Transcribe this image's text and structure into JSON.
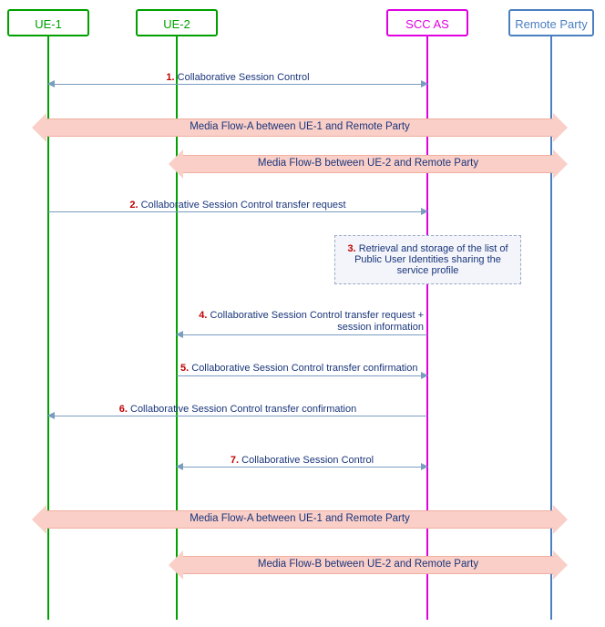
{
  "actors": {
    "ue1": "UE-1",
    "ue2": "UE-2",
    "sccas": "SCC AS",
    "rp": "Remote Party"
  },
  "messages": {
    "m1": {
      "num": "1.",
      "text": "Collaborative Session Control"
    },
    "m2": {
      "num": "2.",
      "text": "Collaborative Session Control transfer request"
    },
    "m4": {
      "num": "4.",
      "text": "Collaborative Session Control transfer request + session information"
    },
    "m5": {
      "num": "5.",
      "text": "Collaborative Session Control transfer confirmation"
    },
    "m6": {
      "num": "6.",
      "text": "Collaborative Session Control transfer confirmation"
    },
    "m7": {
      "num": "7.",
      "text": "Collaborative Session Control"
    }
  },
  "note": {
    "num": "3.",
    "text": "Retrieval and storage of the list of Public User Identities sharing the service profile"
  },
  "media": {
    "a": "Media Flow-A between UE-1 and Remote Party",
    "b": "Media Flow-B between UE-2 and Remote Party"
  }
}
